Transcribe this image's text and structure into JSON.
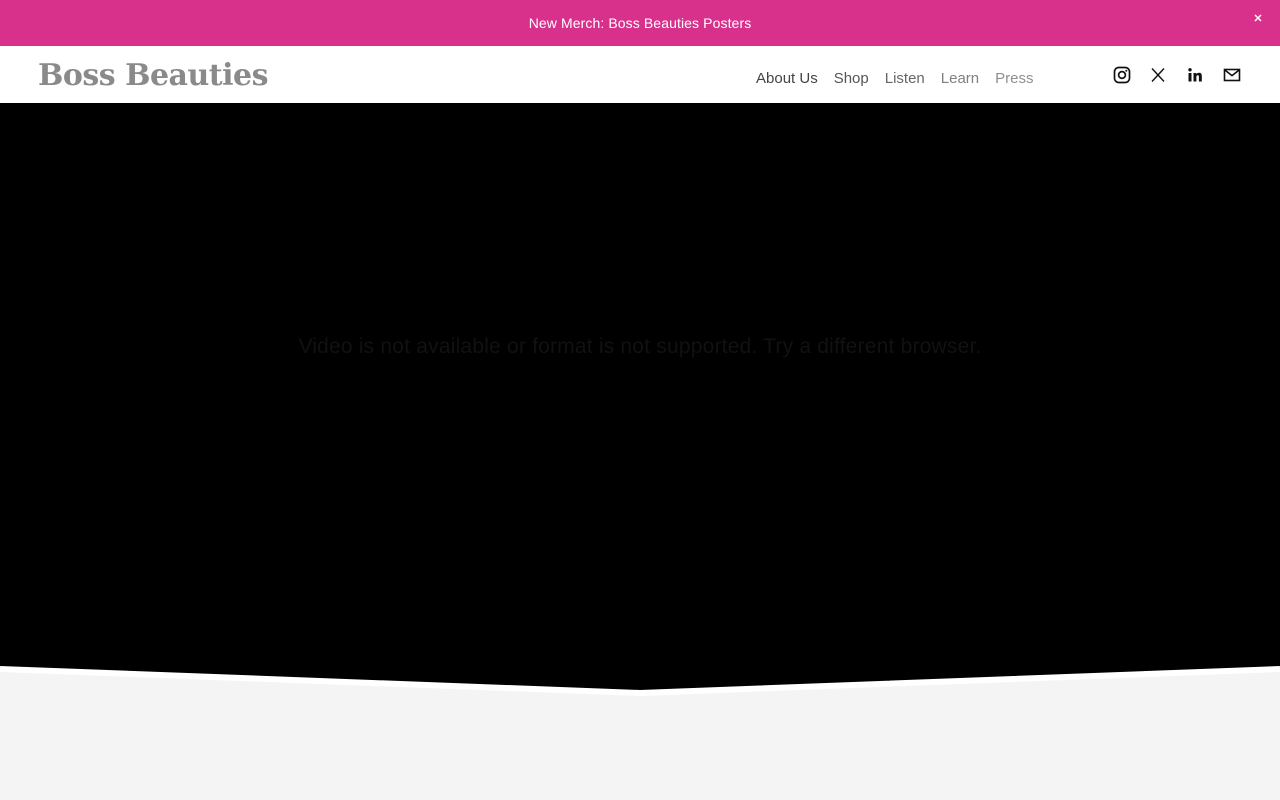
{
  "announcement": {
    "text": "New Merch: Boss Beauties Posters",
    "background": "#d8318c"
  },
  "header": {
    "logo": "Boss Beauties",
    "nav": [
      {
        "label": "About Us"
      },
      {
        "label": "Shop"
      },
      {
        "label": "Listen"
      },
      {
        "label": "Learn"
      },
      {
        "label": "Press"
      }
    ],
    "social": [
      {
        "icon": "instagram-icon"
      },
      {
        "icon": "x-twitter-icon"
      },
      {
        "icon": "linkedin-icon"
      },
      {
        "icon": "email-icon"
      }
    ]
  },
  "hero": {
    "video_message": "Video is not available or format is not supported. Try a different browser.",
    "background": "#000000"
  },
  "page": {
    "background": "#f4f4f4"
  }
}
